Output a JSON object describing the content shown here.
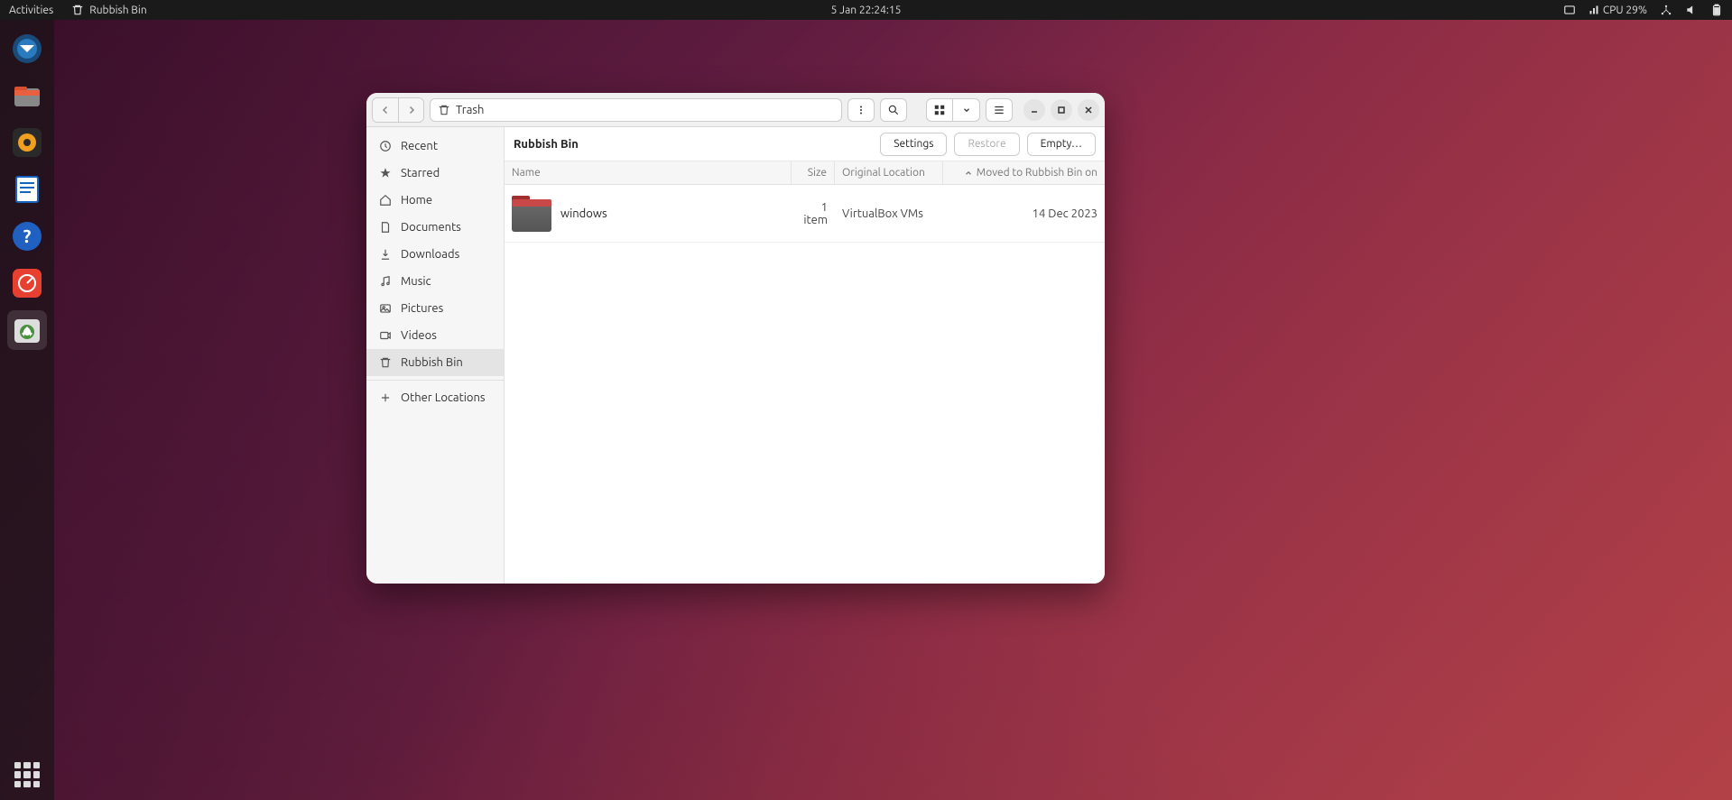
{
  "topbar": {
    "activities": "Activities",
    "app_name": "Rubbish Bin",
    "datetime": "5 Jan  22:24:15",
    "cpu": "CPU 29%"
  },
  "dock": {
    "items": [
      {
        "name": "thunderbird"
      },
      {
        "name": "files"
      },
      {
        "name": "rhythmbox"
      },
      {
        "name": "libreoffice-writer"
      },
      {
        "name": "help"
      },
      {
        "name": "system-monitor"
      },
      {
        "name": "rubbish-bin-app"
      }
    ]
  },
  "window": {
    "path_label": "Trash",
    "sidebar": [
      {
        "key": "recent",
        "label": "Recent"
      },
      {
        "key": "starred",
        "label": "Starred"
      },
      {
        "key": "home",
        "label": "Home"
      },
      {
        "key": "documents",
        "label": "Documents"
      },
      {
        "key": "downloads",
        "label": "Downloads"
      },
      {
        "key": "music",
        "label": "Music"
      },
      {
        "key": "pictures",
        "label": "Pictures"
      },
      {
        "key": "videos",
        "label": "Videos"
      },
      {
        "key": "rubbish",
        "label": "Rubbish Bin",
        "selected": true
      },
      {
        "key": "other",
        "label": "Other Locations"
      }
    ],
    "content": {
      "title": "Rubbish Bin",
      "buttons": {
        "settings": "Settings",
        "restore": "Restore",
        "empty": "Empty…"
      },
      "columns": {
        "name": "Name",
        "size": "Size",
        "orig": "Original Location",
        "date": "Moved to Rubbish Bin on"
      },
      "rows": [
        {
          "name": "windows",
          "size": "1 item",
          "orig": "VirtualBox VMs",
          "date": "14 Dec 2023"
        }
      ]
    }
  }
}
